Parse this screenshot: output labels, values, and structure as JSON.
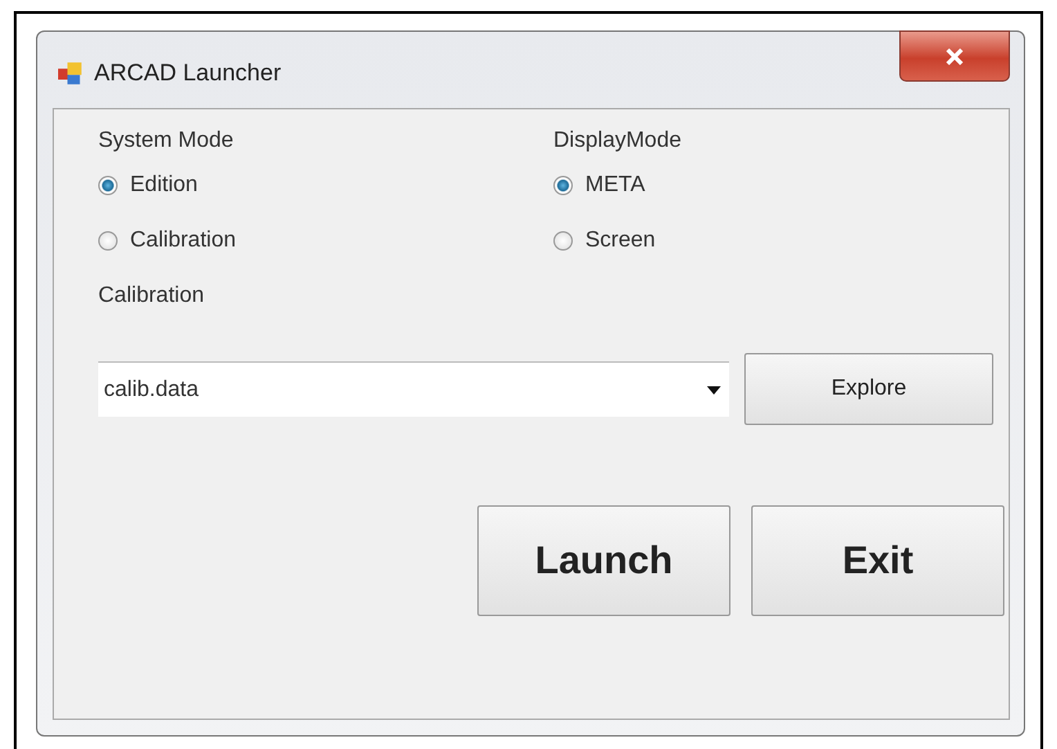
{
  "window": {
    "title": "ARCAD Launcher"
  },
  "groups": [
    {
      "label": "System Mode",
      "options": [
        {
          "label": "Edition",
          "selected": true
        },
        {
          "label": "Calibration",
          "selected": false
        }
      ]
    },
    {
      "label": "DisplayMode",
      "options": [
        {
          "label": "META",
          "selected": true
        },
        {
          "label": "Screen",
          "selected": false
        }
      ]
    }
  ],
  "calibration": {
    "label": "Calibration",
    "value": "calib.data",
    "button": "Explore"
  },
  "buttons": [
    "Launch",
    "Exit"
  ]
}
